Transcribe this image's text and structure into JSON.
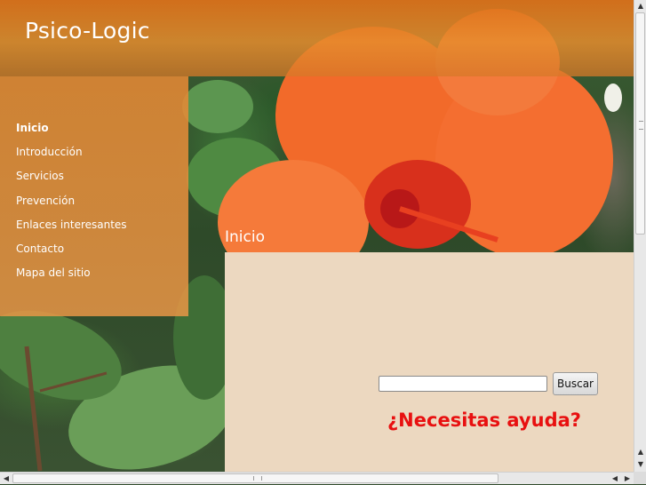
{
  "site": {
    "title": "Psico-Logic"
  },
  "nav": {
    "items": [
      {
        "label": "Inicio",
        "active": true
      },
      {
        "label": "Introducción",
        "active": false
      },
      {
        "label": "Servicios",
        "active": false
      },
      {
        "label": "Prevención",
        "active": false
      },
      {
        "label": "Enlaces interesantes",
        "active": false
      },
      {
        "label": "Contacto",
        "active": false
      },
      {
        "label": "Mapa del sitio",
        "active": false
      }
    ]
  },
  "main": {
    "section_title": "Inicio",
    "search": {
      "value": "",
      "button_label": "Buscar"
    },
    "help_text": "¿Necesitas ayuda?"
  },
  "icons": {
    "scroll_up": "arrow-up-icon",
    "scroll_down": "arrow-down-icon",
    "scroll_left": "arrow-left-icon",
    "scroll_right": "arrow-right-icon"
  },
  "colors": {
    "header": "#de7019",
    "sidebar": "#e48834",
    "content_panel": "#ecd8c0",
    "help_text": "#e81010"
  }
}
